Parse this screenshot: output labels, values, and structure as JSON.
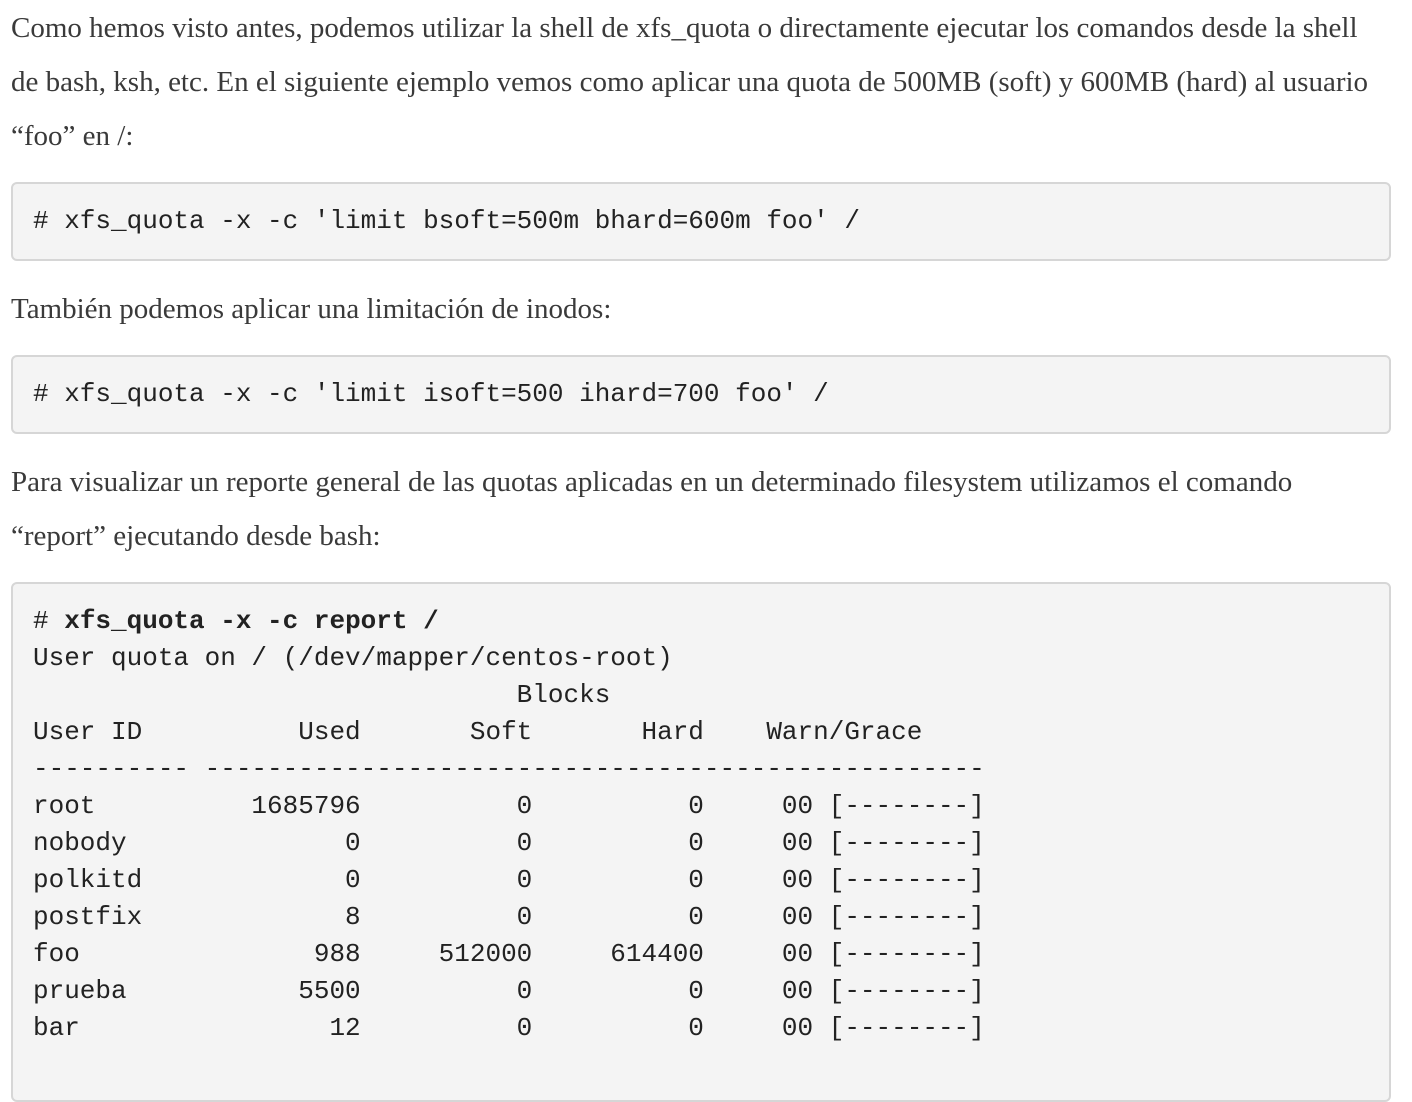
{
  "paragraphs": {
    "p1": "Como hemos visto antes, podemos utilizar la shell de xfs_quota o directamente ejecutar los comandos desde la shell de bash, ksh, etc. En el siguiente ejemplo vemos como aplicar una quota de 500MB (soft) y 600MB (hard) al usuario “foo” en /:",
    "p2": "También podemos aplicar una limitación de inodos:",
    "p3": "Para visualizar un reporte general de las quotas aplicadas en un determinado filesystem utilizamos el comando “report” ejecutando desde bash:"
  },
  "code_blocks": {
    "block1": "# xfs_quota -x -c 'limit bsoft=500m bhard=600m foo' /",
    "block2": "# xfs_quota -x -c 'limit isoft=500 ihard=700 foo' /",
    "block3": {
      "prompt": "# ",
      "command": "xfs_quota -x -c report /",
      "output": "User quota on / (/dev/mapper/centos-root)\n                               Blocks\nUser ID          Used       Soft       Hard    Warn/Grace\n---------- --------------------------------------------------\nroot          1685796          0          0     00 [--------]\nnobody              0          0          0     00 [--------]\npolkitd             0          0          0     00 [--------]\npostfix             8          0          0     00 [--------]\nfoo               988     512000     614400     00 [--------]\nprueba           5500          0          0     00 [--------]\nbar                12          0          0     00 [--------]"
    }
  }
}
